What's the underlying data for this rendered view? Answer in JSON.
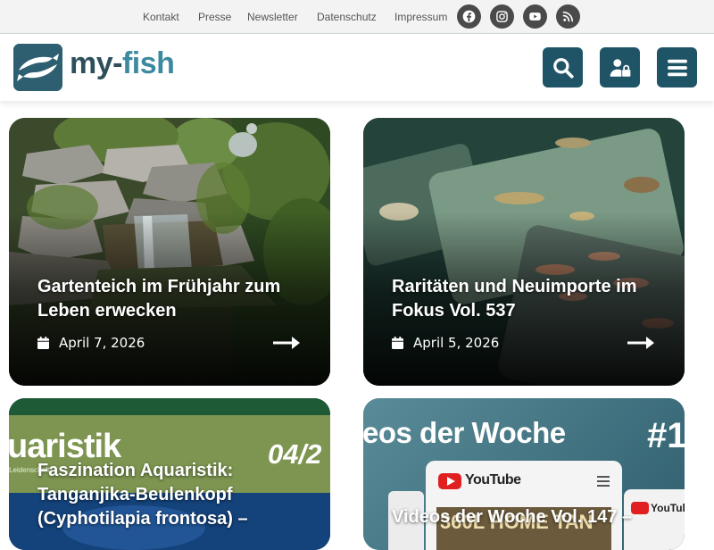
{
  "topnav": {
    "links": [
      "Kontakt",
      "Presse",
      "Newsletter",
      "Datenschutz",
      "Impressum"
    ],
    "social_icons": [
      "facebook-icon",
      "instagram-icon",
      "youtube-icon",
      "rss-icon"
    ]
  },
  "brand": {
    "logo_part1": "my-",
    "logo_part2": "fish",
    "colors": {
      "primary": "#1f5467",
      "logo_dark": "#2d4f5c",
      "logo_light": "#3d8aa0",
      "social_bg": "#4a4a4a"
    }
  },
  "header_buttons": [
    "search-icon",
    "user-lock-icon",
    "menu-icon"
  ],
  "articles": [
    {
      "title": "Gartenteich im Frühjahr zum Leben erwecken",
      "date": "April 7, 2026"
    },
    {
      "title": "Raritäten und Neuimporte im Fokus Vol. 537",
      "date": "April 5, 2026"
    },
    {
      "title": "Faszination Aquaristik: Tanganjika-Beulenkopf (Cyphotilapia frontosa) –",
      "banner": {
        "brand": "uaristik",
        "subtitle": "Leidenschaft",
        "issue": "04/2"
      }
    },
    {
      "title": "Videos der Woche Vol. 147 –",
      "banner": {
        "heading": "eos der Woche",
        "number": "#1",
        "yt_label": "YouTube",
        "yt_label2": "YouTub",
        "thumb_text": "360L HOME TAN"
      }
    }
  ]
}
